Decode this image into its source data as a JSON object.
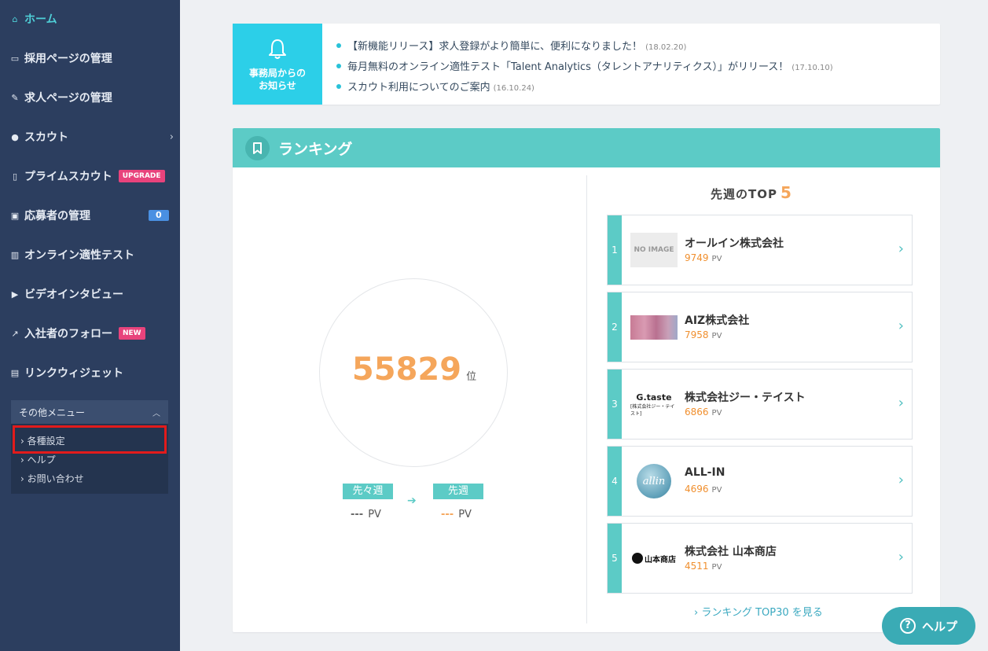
{
  "sidebar": {
    "items": [
      {
        "label": "ホーム",
        "icon": "home-icon",
        "glyph": "⌂"
      },
      {
        "label": "採用ページの管理",
        "icon": "laptop-icon",
        "glyph": "▭"
      },
      {
        "label": "求人ページの管理",
        "icon": "edit-icon",
        "glyph": "✎"
      },
      {
        "label": "スカウト",
        "icon": "user-icon",
        "glyph": "●",
        "chevron": "›"
      },
      {
        "label": "プライムスカウト",
        "icon": "bookmark-icon",
        "glyph": "▯",
        "badge": "UPGRADE"
      },
      {
        "label": "応募者の管理",
        "icon": "download-icon",
        "glyph": "▣",
        "badge": "0"
      },
      {
        "label": "オンライン適性テスト",
        "icon": "bar-chart-icon",
        "glyph": "▥"
      },
      {
        "label": "ビデオインタビュー",
        "icon": "video-icon",
        "glyph": "▶"
      },
      {
        "label": "入社者のフォロー",
        "icon": "line-chart-icon",
        "glyph": "↗",
        "badge": "NEW"
      },
      {
        "label": "リンクウィジェット",
        "icon": "file-code-icon",
        "glyph": "▤"
      }
    ],
    "other_menu": {
      "title": "その他メニュー",
      "toggle": "︿",
      "links": [
        "各種設定",
        "ヘルプ",
        "お問い合わせ"
      ]
    }
  },
  "notice": {
    "title_line1": "事務局からの",
    "title_line2": "お知らせ",
    "items": [
      {
        "text": "【新機能リリース】求人登録がより簡単に、便利になりました！",
        "date": "(18.02.20)"
      },
      {
        "text": "毎月無料のオンライン適性テスト「Talent Analytics（タレントアナリティクス）」がリリース！",
        "date": "(17.10.10)"
      },
      {
        "text": "スカウト利用についてのご案内",
        "date": "(16.10.24)"
      }
    ]
  },
  "ranking": {
    "title": "ランキング",
    "my_rank": "55829",
    "rank_unit": "位",
    "prev_prev_week_label": "先々週",
    "prev_week_label": "先週",
    "prev_prev_week_value": "---",
    "prev_week_value": "---",
    "pv_unit": "PV",
    "arrow": "➔",
    "top5_title": "先週のTOP",
    "top5_num": "5",
    "no_image": "NO IMAGE",
    "companies": [
      {
        "rank": "1",
        "name": "オールイン株式会社",
        "pv": "9749"
      },
      {
        "rank": "2",
        "name": "AIZ株式会社",
        "pv": "7958"
      },
      {
        "rank": "3",
        "name": "株式会社ジー・テイスト",
        "pv": "6866"
      },
      {
        "rank": "4",
        "name": "ALL-IN",
        "pv": "4696"
      },
      {
        "rank": "5",
        "name": "株式会社 山本商店",
        "pv": "4511"
      }
    ],
    "logo_texts": {
      "gtaste": "G.taste",
      "gtaste_sub": "[株式会社ジー・テイスト]",
      "allin": "allin",
      "yamamoto": "山本商店"
    },
    "top30_link": "› ランキング TOP30 を見る"
  },
  "help_button": {
    "label": "ヘルプ",
    "glyph": "?"
  },
  "colors": {
    "sidebar_bg": "#2c3e5f",
    "accent_teal": "#5ccbc6",
    "notice_cyan": "#2ccfe8",
    "rank_orange": "#f5a65b",
    "highlight_red": "#e21b1b"
  }
}
